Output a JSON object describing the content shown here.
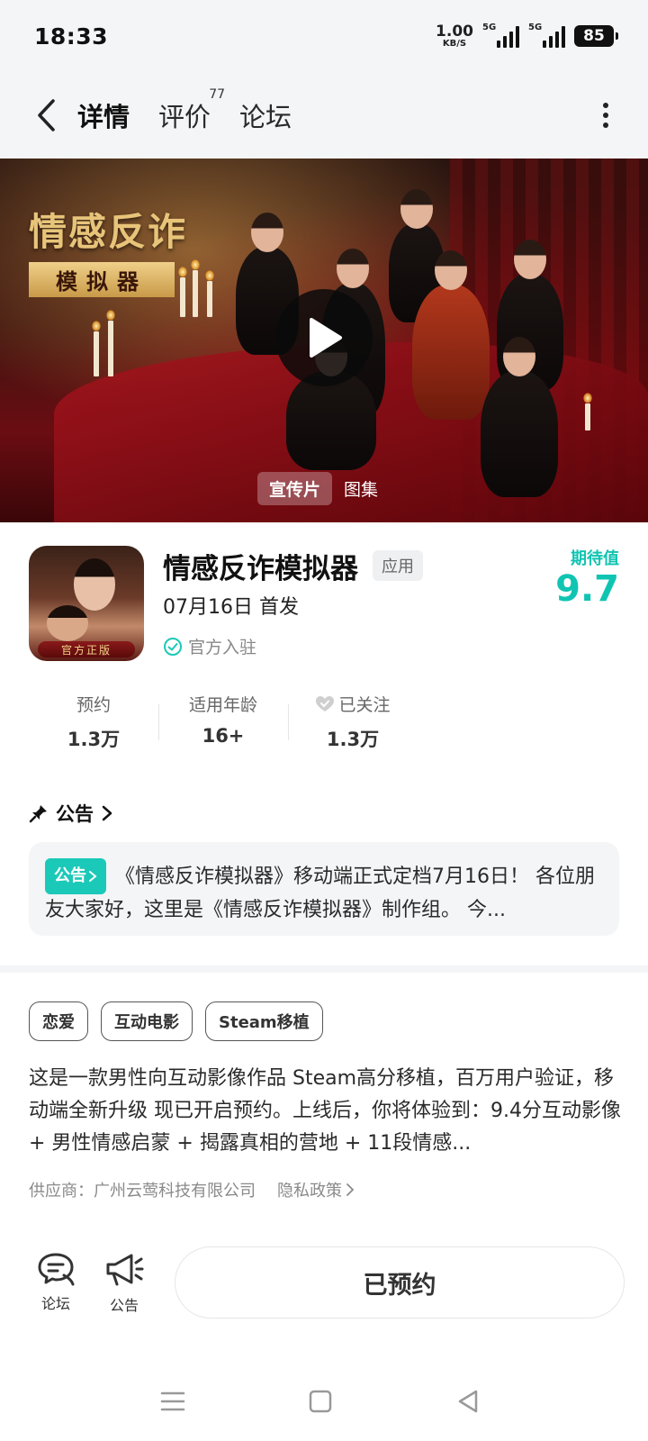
{
  "status_bar": {
    "time": "18:33",
    "net_speed_value": "1.00",
    "net_speed_unit": "KB/S",
    "sim1_label": "5G",
    "sim2_label": "5G",
    "battery": "85"
  },
  "nav": {
    "tabs": [
      {
        "label": "详情",
        "active": true
      },
      {
        "label": "评价",
        "count": "77"
      },
      {
        "label": "论坛"
      }
    ]
  },
  "hero": {
    "logo_line1": "情感反诈",
    "logo_line2": "模拟器",
    "media_tabs": [
      {
        "label": "宣传片",
        "active": true
      },
      {
        "label": "图集"
      }
    ]
  },
  "app": {
    "name": "情感反诈模拟器",
    "type_badge": "应用",
    "release": "07月16日 首发",
    "official": "官方入驻",
    "icon_badge": "官方正版",
    "expect_label": "期待值",
    "expect_value": "9.7"
  },
  "stats": [
    {
      "label": "预约",
      "value": "1.3万"
    },
    {
      "label": "适用年龄",
      "value": "16+"
    },
    {
      "label": "已关注",
      "value": "1.3万"
    }
  ],
  "notice": {
    "section_title": "公告",
    "tag": "公告",
    "text": "《情感反诈模拟器》移动端正式定档7月16日！ 各位朋友大家好，这里是《情感反诈模拟器》制作组。 今..."
  },
  "tags": [
    "恋爱",
    "互动电影",
    "Steam移植"
  ],
  "description": "这是一款男性向互动影像作品 Steam高分移植，百万用户验证，移动端全新升级 现已开启预约。上线后，你将体验到：9.4分互动影像 + 男性情感启蒙 + 揭露真相的营地 + 11段情感...",
  "supplier": {
    "text": "供应商：广州云莺科技有限公司",
    "privacy": "隐私政策"
  },
  "bottom_bar": {
    "forum_label": "论坛",
    "notice_label": "公告",
    "reserve_label": "已预约"
  },
  "colors": {
    "accent": "#1bc9b8",
    "expect": "#10c4b2",
    "background": "#ffffff",
    "header_bg": "#f4f5f7"
  },
  "icons": [
    "back-arrow-icon",
    "more-vertical-icon",
    "play-icon",
    "check-circle-icon",
    "heart-icon",
    "pin-icon",
    "chevron-right-icon",
    "forum-chat-icon",
    "megaphone-icon",
    "menu-lines-icon",
    "home-square-icon",
    "back-triangle-icon"
  ]
}
